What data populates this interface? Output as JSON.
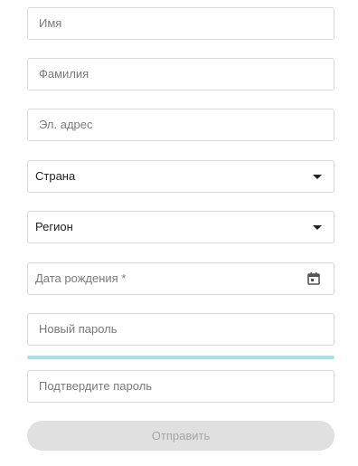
{
  "form": {
    "first_name": {
      "placeholder": "Имя"
    },
    "last_name": {
      "placeholder": "Фамилия"
    },
    "email": {
      "placeholder": "Эл. адрес"
    },
    "country": {
      "value": "Страна",
      "icon": "chevron-down-icon"
    },
    "region": {
      "value": "Регион",
      "icon": "chevron-down-icon"
    },
    "birth_date": {
      "placeholder": "Дата рождения *",
      "icon": "calendar-icon"
    },
    "new_password": {
      "placeholder": "Новый пароль"
    },
    "password_strength": {
      "color": "#a5e4ef"
    },
    "confirm_password": {
      "placeholder": "Подтвердите пароль"
    },
    "submit": {
      "label": "Отправить",
      "disabled": true
    }
  }
}
